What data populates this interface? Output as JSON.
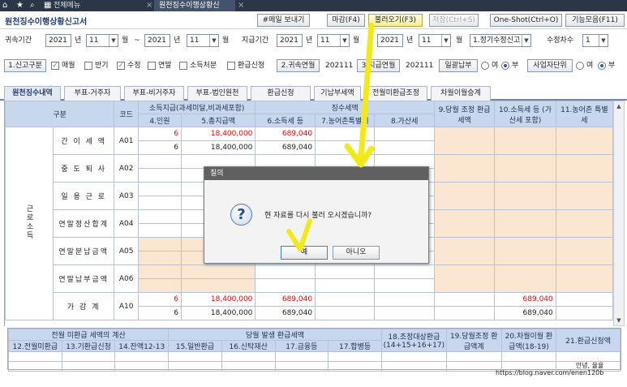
{
  "tabbar": {
    "tabs": [
      "전체메뉴",
      "원천징수이행상황신"
    ],
    "close_glyph": "×"
  },
  "window": {
    "title": "원천징수이행상황신고서",
    "buttons": [
      "#메일 보내기",
      "마감(F4)",
      "불러오기(F3)",
      "저장(Ctrl+S)",
      "One-Shot(Ctrl+O)",
      "기능모음(F11)"
    ]
  },
  "filters": {
    "period_label": "귀속기간",
    "year_unit": "년",
    "month_unit": "월",
    "tilde": "~",
    "period_from_year": "2021",
    "period_from_month": "11",
    "period_to_year": "2021",
    "period_to_month": "11",
    "pay_label": "지급기간",
    "pay_from_year": "2021",
    "pay_from_month": "11",
    "pay_to_year": "2021",
    "pay_to_month": "11",
    "report_type": "1.정기수정신고",
    "revision_label": "수정차수",
    "revision_value": "1"
  },
  "options": {
    "report_kind_btn": "1.신고구분",
    "monthly": "매월",
    "half_year": "반기",
    "amend": "수정",
    "year_end": "연말",
    "income_disposal": "소득처분",
    "refund_request": "환급신청",
    "attribution_btn": "2.귀속연월",
    "attribution_value": "202111",
    "payment_btn": "3.지급연월",
    "payment_value": "202111",
    "lump_sum_btn": "일괄납부",
    "yes": "여",
    "no": "부",
    "business_unit_btn": "사업자단위"
  },
  "subtabs": [
    "원천징수내역",
    "부표-거주자",
    "부표-비거주자",
    "부표-법인원천",
    "환급신청",
    "기납부세액",
    "전월미환급조정",
    "차월이월승계"
  ],
  "grid": {
    "headers": {
      "category": "구분",
      "code": "코드",
      "income_paid": "소득지급(과세미달,비과세포함)",
      "tax_collected": "징수세액",
      "h4": "4.인원",
      "h5": "5.총지급액",
      "h6": "6.소득세 등",
      "h7": "7.농어촌특별세",
      "h8": "8.가산세",
      "h9": "9.당월 조정 환급세액",
      "h10": "10.소득세 등 (가산세 포함)",
      "h11": "11.농어촌 특별세"
    },
    "group_label": "근로소득",
    "rows": [
      {
        "label": "간 이 세 액",
        "code": "A01",
        "count_top": "6",
        "total_top": "18,400,000",
        "tax_top": "689,040",
        "count": "6",
        "total": "18,400,000",
        "tax": "689,040",
        "final_tax_top": "",
        "final_tax": ""
      },
      {
        "label": "중 도 퇴 사",
        "code": "A02"
      },
      {
        "label": "일 용 근 로",
        "code": "A03"
      },
      {
        "label": "연말정산합계",
        "code": "A04"
      },
      {
        "label": "연말분납금액",
        "code": "A05"
      },
      {
        "label": "연말납부금액",
        "code": "A06"
      },
      {
        "label": "가 감 계",
        "code": "A10",
        "count_top": "6",
        "total_top": "18,400,000",
        "tax_top": "689,040",
        "count": "6",
        "total": "18,400,000",
        "tax": "689,040",
        "final_tax_top": "689,040",
        "final_tax": "689,040"
      }
    ]
  },
  "bottom": {
    "prev_refund_calc": "전월 미환급 세액의 계산",
    "current_refund": "당월 발생 환급세액",
    "c12": "12.전월미환급",
    "c13": "13.기환급신청",
    "c14": "14.잔액12-13",
    "c15": "15.일반환급",
    "c16": "16.신탁재산",
    "c17": "17.금융등",
    "c17b": "17.합병등",
    "c18": "18.조정대상환급 (14+15+16+17)",
    "c19": "19.당월조정 환급액계",
    "c20": "20.차월이월 환급액(18-19)",
    "c21": "21.환급신청액"
  },
  "watermark": {
    "blog": "안녕, 율율",
    "url": "https://blog.naver.com/enen120b"
  },
  "dialog": {
    "title": "질의",
    "message": "현 자료를 다시 불러 오시겠습니까?",
    "yes": "예",
    "no": "아니오"
  },
  "colors": {
    "header_bg": "#c8d7ee",
    "peach": "#fbe6d2",
    "red_text": "#e00000",
    "annotation_yellow": "#f2ea18",
    "tabbar": "#2b3646"
  }
}
